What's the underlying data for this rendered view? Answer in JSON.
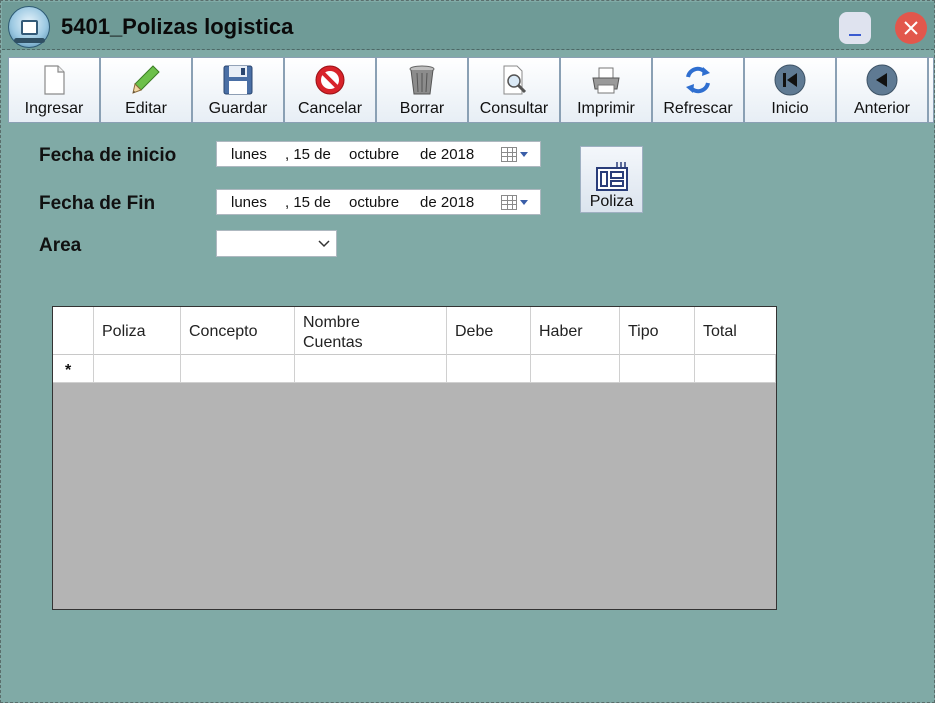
{
  "window": {
    "title": "5401_Polizas logistica"
  },
  "toolbar": {
    "buttons": [
      {
        "label": "Ingresar",
        "icon": "new-document-icon"
      },
      {
        "label": "Editar",
        "icon": "pencil-icon"
      },
      {
        "label": "Guardar",
        "icon": "floppy-disk-icon"
      },
      {
        "label": "Cancelar",
        "icon": "no-entry-icon"
      },
      {
        "label": "Borrar",
        "icon": "trash-can-icon"
      },
      {
        "label": "Consultar",
        "icon": "magnifier-document-icon"
      },
      {
        "label": "Imprimir",
        "icon": "printer-icon"
      },
      {
        "label": "Refrescar",
        "icon": "refresh-icon"
      },
      {
        "label": "Inicio",
        "icon": "first-record-icon"
      },
      {
        "label": "Anterior",
        "icon": "previous-record-icon"
      }
    ]
  },
  "form": {
    "fecha_inicio": {
      "label": "Fecha de inicio",
      "weekday": "lunes",
      "day": ", 15 de",
      "month": "octubre",
      "year": "de 2018"
    },
    "fecha_fin": {
      "label": "Fecha de Fin",
      "weekday": "lunes",
      "day": ", 15 de",
      "month": "octubre",
      "year": "de 2018"
    },
    "area": {
      "label": "Area",
      "value": ""
    },
    "poliza_button": {
      "label": "Poliza"
    }
  },
  "grid": {
    "columns": [
      "Poliza",
      "Concepto",
      "Nombre Cuentas",
      "Debe",
      "Haber",
      "Tipo",
      "Total"
    ],
    "column_lines": [
      [
        "Poliza"
      ],
      [
        "Concepto"
      ],
      [
        "Nombre",
        "Cuentas"
      ],
      [
        "Debe"
      ],
      [
        "Haber"
      ],
      [
        "Tipo"
      ],
      [
        "Total"
      ]
    ],
    "new_row_marker": "*"
  },
  "colors": {
    "background": "#80aaa6",
    "titlebar": "#6f9b97",
    "close_button": "#e2574c",
    "grid_empty_area": "#b4b4b4"
  }
}
